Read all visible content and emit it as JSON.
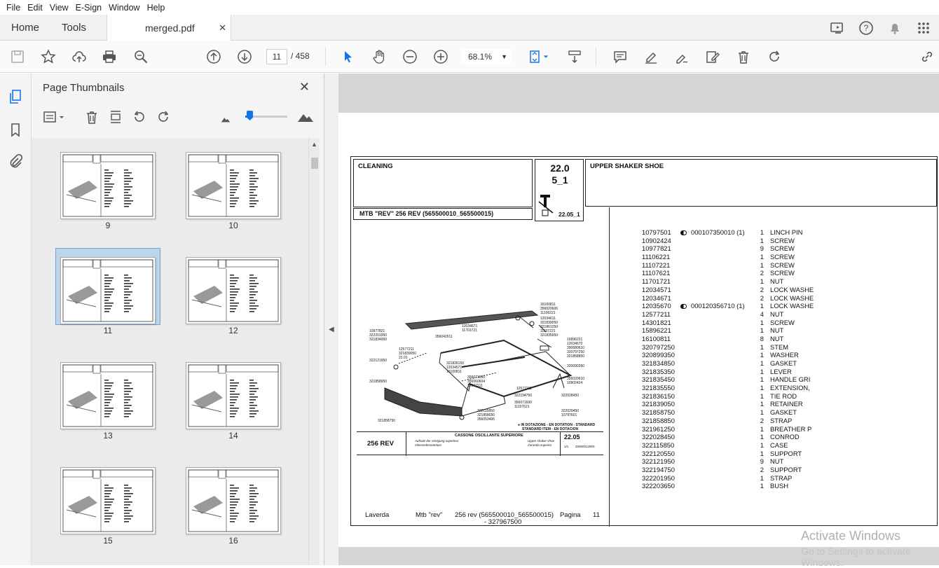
{
  "menu": [
    "File",
    "Edit",
    "View",
    "E-Sign",
    "Window",
    "Help"
  ],
  "tabs": {
    "home": "Home",
    "tools": "Tools",
    "document": "merged.pdf"
  },
  "toolbar": {
    "page_current": "11",
    "page_total": "/ 458",
    "zoom": "68.1%"
  },
  "thumb_panel": {
    "title": "Page Thumbnails",
    "pages": [
      "9",
      "10",
      "11",
      "12",
      "13",
      "14",
      "15",
      "16"
    ],
    "selected_page": "11"
  },
  "doc": {
    "section": "CLEANING",
    "code_line1": "22.0",
    "code_line2": "5_1",
    "code_small": "22.05_1",
    "title_right": "UPPER SHAKER SHOE",
    "model": "MTB \"REV\" 256 REV (565500010_565500015)",
    "drawing": {
      "model": "256 REV",
      "title": "CASSONE OSCILLANTE SUPERIORE",
      "subtitle_it1": "Aufsatz der reinigung superieur",
      "subtitle_it2": "Obersiebmanteluer",
      "subtitle_en1": "Upper shaker shoe",
      "subtitle_en2": "Zaranda superior",
      "code": "22.05",
      "page_small": "1/1",
      "ref": "32650012903",
      "legend1": "● IN DOTAZIONE - EN DOTATION - STANDARD",
      "legend2": "STANDARD ITEM - EN DOTACION"
    },
    "footer": {
      "brand": "Laverda",
      "model": "Mtb \"rev\"",
      "range": "256 rev (565500010_565500015)",
      "range2": "- 327967500",
      "page_label": "Pagina",
      "page_no": "11"
    },
    "parts": [
      {
        "code": "10797501",
        "ref": "000107350010  (1)",
        "dot": true,
        "qty": "1",
        "desc": "LINCH PIN"
      },
      {
        "code": "10902424",
        "ref": "",
        "dot": false,
        "qty": "1",
        "desc": "SCREW"
      },
      {
        "code": "10977821",
        "ref": "",
        "dot": false,
        "qty": "9",
        "desc": "SCREW"
      },
      {
        "code": "11106221",
        "ref": "",
        "dot": false,
        "qty": "1",
        "desc": "SCREW"
      },
      {
        "code": "11107221",
        "ref": "",
        "dot": false,
        "qty": "1",
        "desc": "SCREW"
      },
      {
        "code": "11107621",
        "ref": "",
        "dot": false,
        "qty": "2",
        "desc": "SCREW"
      },
      {
        "code": "11701721",
        "ref": "",
        "dot": false,
        "qty": "1",
        "desc": "NUT"
      },
      {
        "code": "12034571",
        "ref": "",
        "dot": false,
        "qty": "2",
        "desc": "LOCK WASHE"
      },
      {
        "code": "12034671",
        "ref": "",
        "dot": false,
        "qty": "2",
        "desc": "LOCK WASHE"
      },
      {
        "code": "12035670",
        "ref": "000120356710  (1)",
        "dot": true,
        "qty": "1",
        "desc": "LOCK WASHE"
      },
      {
        "code": "12577211",
        "ref": "",
        "dot": false,
        "qty": "4",
        "desc": "NUT"
      },
      {
        "code": "14301821",
        "ref": "",
        "dot": false,
        "qty": "1",
        "desc": "SCREW"
      },
      {
        "code": "15896221",
        "ref": "",
        "dot": false,
        "qty": "1",
        "desc": "NUT"
      },
      {
        "code": "16100811",
        "ref": "",
        "dot": false,
        "qty": "8",
        "desc": "NUT"
      },
      {
        "code": "320797250",
        "ref": "",
        "dot": false,
        "qty": "1",
        "desc": "STEM"
      },
      {
        "code": "320899350",
        "ref": "",
        "dot": false,
        "qty": "1",
        "desc": "WASHER"
      },
      {
        "code": "321834850",
        "ref": "",
        "dot": false,
        "qty": "1",
        "desc": "GASKET"
      },
      {
        "code": "321835350",
        "ref": "",
        "dot": false,
        "qty": "1",
        "desc": "LEVER"
      },
      {
        "code": "321835450",
        "ref": "",
        "dot": false,
        "qty": "1",
        "desc": "HANDLE GRI"
      },
      {
        "code": "321835550",
        "ref": "",
        "dot": false,
        "qty": "1",
        "desc": "EXTENSION,"
      },
      {
        "code": "321836150",
        "ref": "",
        "dot": false,
        "qty": "1",
        "desc": "TIE ROD"
      },
      {
        "code": "321839050",
        "ref": "",
        "dot": false,
        "qty": "1",
        "desc": "RETAINER"
      },
      {
        "code": "321858750",
        "ref": "",
        "dot": false,
        "qty": "1",
        "desc": "GASKET"
      },
      {
        "code": "321858850",
        "ref": "",
        "dot": false,
        "qty": "2",
        "desc": "STRAP"
      },
      {
        "code": "321961250",
        "ref": "",
        "dot": false,
        "qty": "1",
        "desc": "BREATHER P"
      },
      {
        "code": "322028450",
        "ref": "",
        "dot": false,
        "qty": "1",
        "desc": "CONROD"
      },
      {
        "code": "322115850",
        "ref": "",
        "dot": false,
        "qty": "1",
        "desc": "CASE"
      },
      {
        "code": "322120550",
        "ref": "",
        "dot": false,
        "qty": "1",
        "desc": "SUPPORT"
      },
      {
        "code": "322121950",
        "ref": "",
        "dot": false,
        "qty": "9",
        "desc": "NUT"
      },
      {
        "code": "322194750",
        "ref": "",
        "dot": false,
        "qty": "2",
        "desc": "SUPPORT"
      },
      {
        "code": "322201950",
        "ref": "",
        "dot": false,
        "qty": "1",
        "desc": "STRAP"
      },
      {
        "code": "322203650",
        "ref": "",
        "dot": false,
        "qty": "1",
        "desc": "BUSH"
      }
    ]
  },
  "watermark": {
    "line1": "Activate Windows",
    "line2": "Go to Settings to activate Windows."
  },
  "colors": {
    "accent": "#1473e6",
    "selected_thumb": "#bcd4ec"
  }
}
